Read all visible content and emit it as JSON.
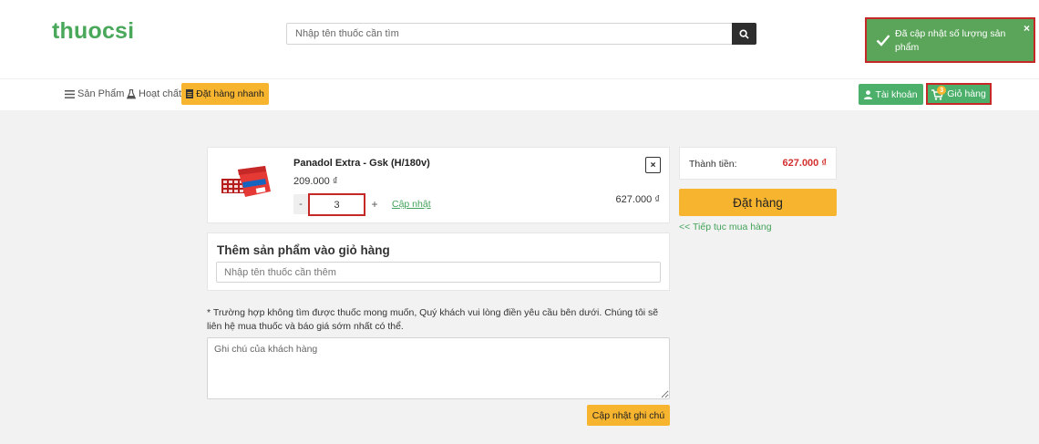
{
  "header": {
    "logo": "thuocsi",
    "search_placeholder": "Nhập tên thuốc cần tìm"
  },
  "toast": {
    "message": "Đã cập nhật số lượng sản phẩm",
    "close": "×"
  },
  "nav": {
    "products": "Sản Phẩm",
    "ingredients": "Hoạt chất",
    "quick_order": "Đặt hàng nhanh",
    "account": "Tài khoản",
    "cart": "Giỏ hàng",
    "cart_count": "3"
  },
  "cart_item": {
    "name": "Panadol Extra - Gsk (H/180v)",
    "price": "209.000 ₫",
    "minus": "-",
    "quantity": "3",
    "plus": "+",
    "update_label": "Cập nhật",
    "remove": "×",
    "line_total": "627.000 ₫"
  },
  "add_product": {
    "title": "Thêm sản phẩm vào giỏ hàng",
    "placeholder": "Nhập tên thuốc cần thêm"
  },
  "note": {
    "instruction": "* Trường hợp không tìm được thuốc mong muốn, Quý khách vui lòng điền yêu cầu bên dưới. Chúng tôi sẽ liên hệ mua thuốc và báo giá sớm nhất có thể.",
    "placeholder": "Ghi chú của khách hàng",
    "button": "Cập nhật ghi chú"
  },
  "summary": {
    "label": "Thành tiền:",
    "total": "627.000 ₫",
    "order_button": "Đặt hàng",
    "continue_link": "<< Tiếp tục mua hàng"
  },
  "colors": {
    "brand_green": "#49a85a",
    "accent_yellow": "#f6b42f",
    "price_red": "#d32f2f",
    "toast_green": "#5ba55b",
    "highlight_red": "#c62828"
  }
}
